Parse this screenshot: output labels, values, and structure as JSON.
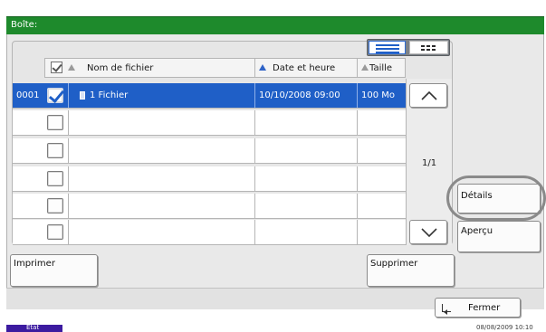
{
  "window": {
    "title": "Boîte:"
  },
  "table": {
    "columns": {
      "name": "Nom de fichier",
      "date": "Date et heure",
      "size": "Taille"
    },
    "rows": [
      {
        "number": "0001",
        "checked": true,
        "name": "1 Fichier",
        "date": "10/10/2008 09:00",
        "size": "100 Mo"
      },
      {
        "number": "",
        "checked": false,
        "name": "",
        "date": "",
        "size": ""
      },
      {
        "number": "",
        "checked": false,
        "name": "",
        "date": "",
        "size": ""
      },
      {
        "number": "",
        "checked": false,
        "name": "",
        "date": "",
        "size": ""
      },
      {
        "number": "",
        "checked": false,
        "name": "",
        "date": "",
        "size": ""
      },
      {
        "number": "",
        "checked": false,
        "name": "",
        "date": "",
        "size": ""
      }
    ]
  },
  "pagination": {
    "label": "1/1"
  },
  "buttons": {
    "details": "Détails",
    "preview": "Aperçu",
    "print": "Imprimer",
    "delete": "Supprimer",
    "close": "Fermer"
  },
  "status": {
    "tab": "État",
    "datetime": "08/08/2009   10:10"
  },
  "colors": {
    "title_bar": "#1e8a2c",
    "selection": "#1f5fc7",
    "status_tab": "#3c1ba0"
  },
  "icons": [
    "list-view-icon",
    "thumbnail-view-icon",
    "sort-arrow-icon",
    "file-icon",
    "chevron-up-icon",
    "chevron-down-icon",
    "return-icon"
  ]
}
